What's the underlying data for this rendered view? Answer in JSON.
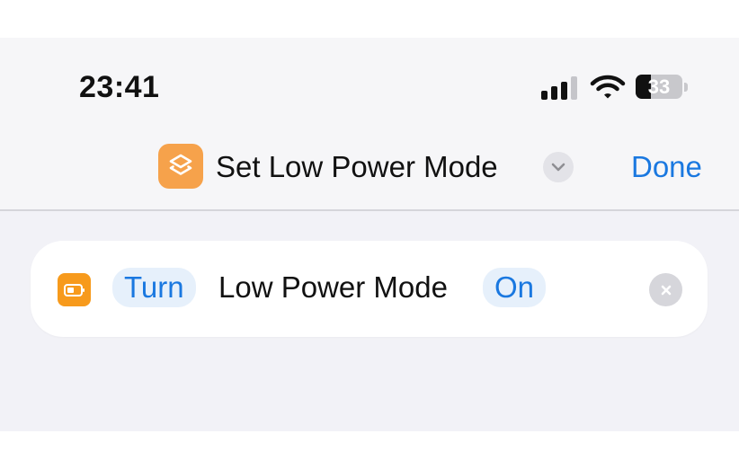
{
  "status_bar": {
    "time": "23:41",
    "battery_level": "33",
    "signal_bars_filled": 3,
    "signal_bars_total": 4
  },
  "nav_bar": {
    "title": "Set Low Power Mode",
    "done_label": "Done",
    "shortcut_icon": "shortcuts-layers-icon",
    "menu_icon": "chevron-down-icon"
  },
  "action": {
    "verb": "Turn",
    "subject": "Low Power Mode",
    "state": "On",
    "icon": "battery-icon",
    "remove_icon": "close-icon"
  },
  "colors": {
    "accent": "#1a78e0",
    "shortcut_icon_bg": "#f6a24b",
    "action_icon_bg": "#f79a1c",
    "pill_bg": "#e6f0fb"
  }
}
